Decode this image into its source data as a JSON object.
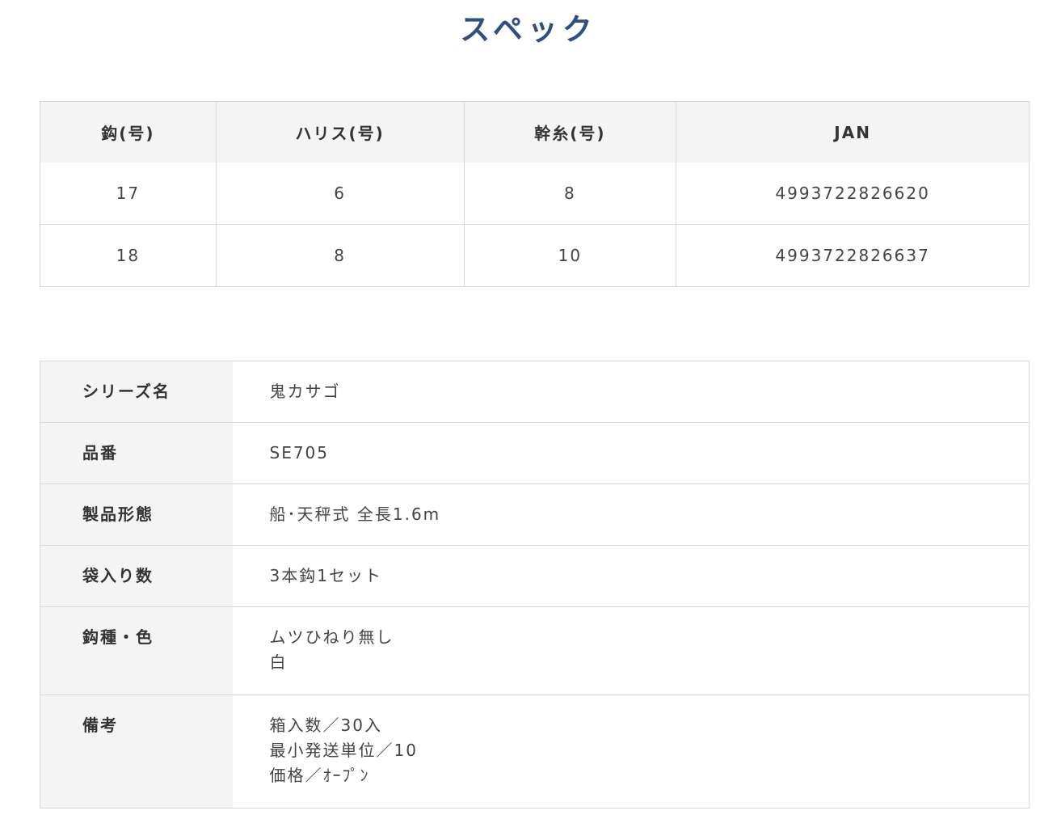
{
  "title": "スペック",
  "size_table": {
    "headers": [
      "鈎(号)",
      "ハリス(号)",
      "幹糸(号)",
      "JAN"
    ],
    "rows": [
      [
        "17",
        "6",
        "8",
        "4993722826620"
      ],
      [
        "18",
        "8",
        "10",
        "4993722826637"
      ]
    ]
  },
  "spec_table": {
    "series_label": "シリーズ名",
    "series_value": "鬼カサゴ",
    "part_label": "品番",
    "part_value": "SE705",
    "form_label": "製品形態",
    "form_value": "船･天秤式 全長1.6m",
    "count_label": "袋入り数",
    "count_value": "3本鈎1セット",
    "hook_label": "鈎種・色",
    "hook_value_1": "ムツひねり無し",
    "hook_value_2": "白",
    "notes_label": "備考",
    "notes_value_1": "箱入数／30入",
    "notes_value_2": "最小発送単位／10",
    "notes_value_3": "価格／ｵｰﾌﾟﾝ"
  }
}
